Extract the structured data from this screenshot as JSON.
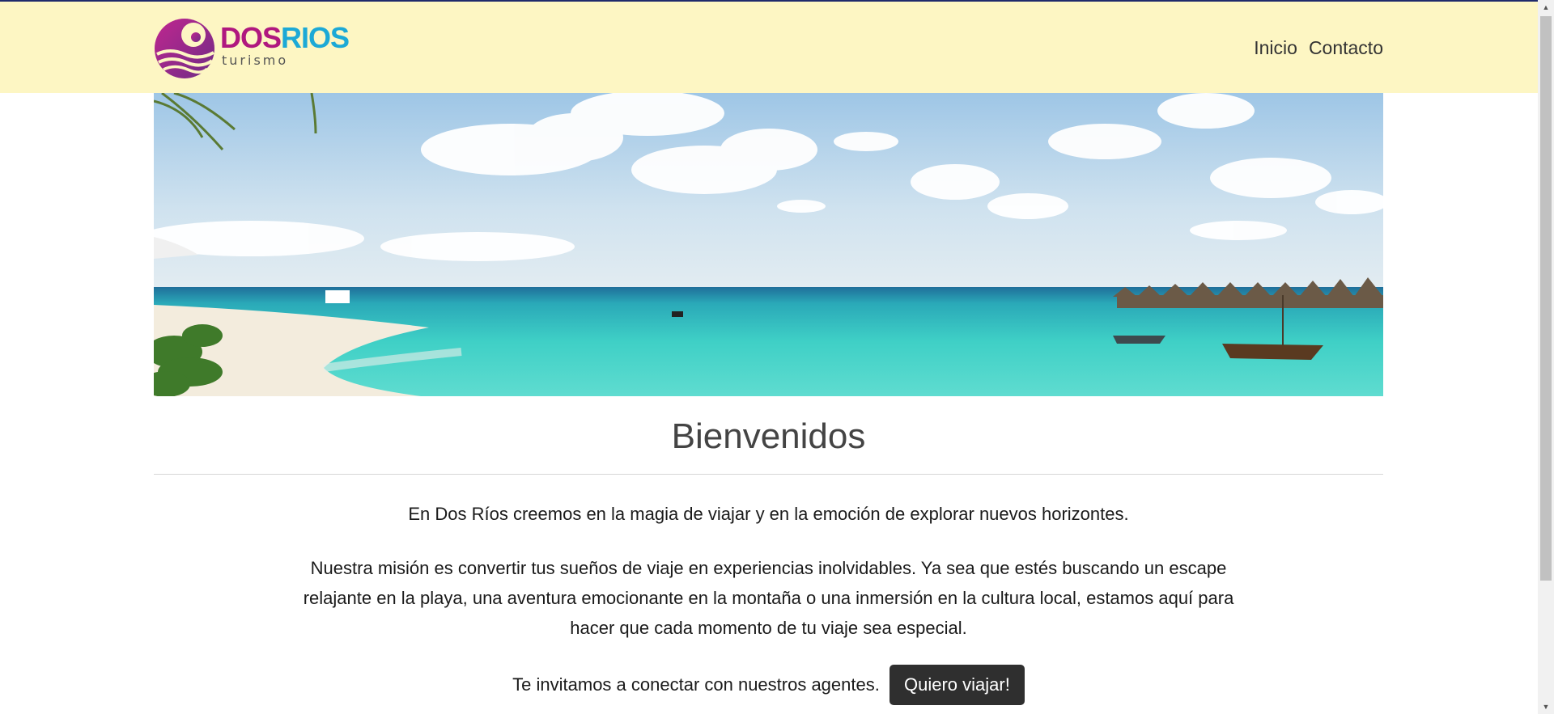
{
  "header": {
    "brand": {
      "name_part1": "DOS",
      "name_part2": "RIOS",
      "subtitle": "turismo"
    },
    "nav": [
      {
        "label": "Inicio"
      },
      {
        "label": "Contacto"
      }
    ]
  },
  "main": {
    "title": "Bienvenidos",
    "intro": "En Dos Ríos creemos en la magia de viajar y en la emoción de explorar nuevos horizontes.",
    "mission": "Nuestra misión es convertir tus sueños de viaje en experiencias inolvidables. Ya sea que estés buscando un escape relajante en la playa, una aventura emocionante en la montaña o una inmersión en la cultura local, estamos aquí para hacer que cada momento de tu viaje sea especial.",
    "cta_text": "Te invitamos a conectar con nuestros agentes.",
    "cta_button": "Quiero viajar!"
  },
  "colors": {
    "navbar_bg": "#fdf6c3",
    "brand_magenta": "#b0187f",
    "brand_cyan": "#1ca9d6",
    "button_bg": "#2f2f2f"
  }
}
